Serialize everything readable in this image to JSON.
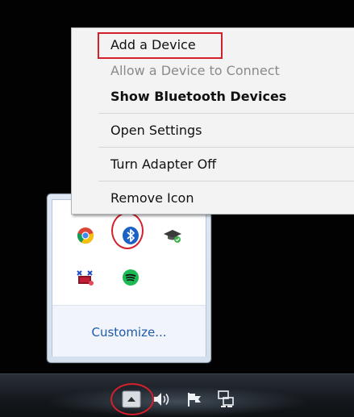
{
  "context_menu": {
    "items": [
      {
        "label": "Add a Device",
        "state": "normal"
      },
      {
        "label": "Allow a Device to Connect",
        "state": "disabled"
      },
      {
        "label": "Show Bluetooth Devices",
        "state": "bold"
      },
      {
        "label": "Open Settings",
        "state": "normal"
      },
      {
        "label": "Turn Adapter Off",
        "state": "normal"
      },
      {
        "label": "Remove Icon",
        "state": "normal"
      }
    ]
  },
  "tray_overflow": {
    "icons": [
      "chrome-icon",
      "bluetooth-icon",
      "graduation-cap-icon",
      "network-alert-icon",
      "spotify-icon"
    ],
    "customize_label": "Customize..."
  },
  "taskbar": {
    "icons": [
      "show-hidden-icons-icon",
      "volume-icon",
      "action-center-flag-icon",
      "network-icon"
    ]
  },
  "colors": {
    "annotation": "#d4202b",
    "link": "#1f5aa6",
    "bluetooth": "#1c62c4",
    "spotify": "#1db954"
  }
}
